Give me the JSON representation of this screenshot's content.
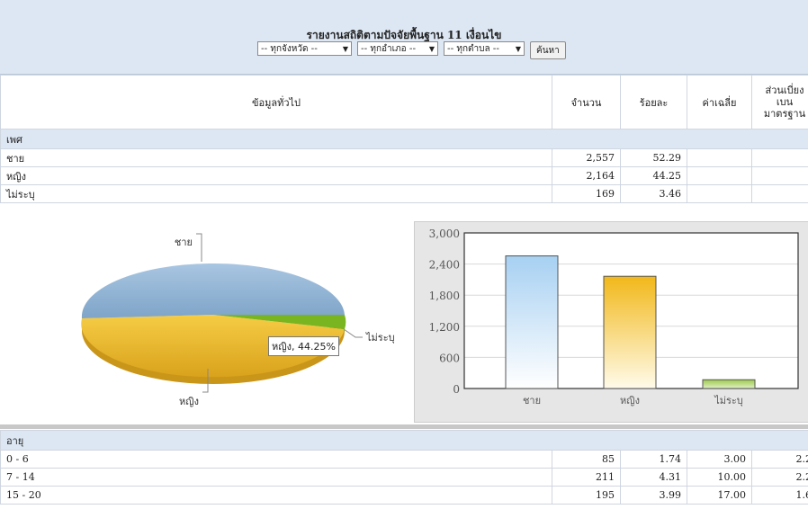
{
  "report": {
    "title": "รายงานสถิติตามปัจจัยพื้นฐาน 11 เงื่อนไข",
    "filters": {
      "province": "-- ทุกจังหวัด --",
      "district": "-- ทุกอำเภอ --",
      "subdistrict": "-- ทุกตำบล --",
      "search_label": "ค้นหา"
    }
  },
  "columns": {
    "general": "ข้อมูลทั่วไป",
    "count": "จำนวน",
    "percent": "ร้อยละ",
    "mean": "ค่าเฉลี่ย",
    "sd_line1": "ส่วนเบี่ยง",
    "sd_line2": "เบน",
    "sd_line3": "มาตรฐาน"
  },
  "sections": {
    "gender": {
      "label": "เพศ",
      "rows": [
        {
          "name": "ชาย",
          "count": "2,557",
          "percent": "52.29",
          "mean": "",
          "sd": ""
        },
        {
          "name": "หญิง",
          "count": "2,164",
          "percent": "44.25",
          "mean": "",
          "sd": ""
        },
        {
          "name": "ไม่ระบุ",
          "count": "169",
          "percent": "3.46",
          "mean": "",
          "sd": ""
        }
      ]
    },
    "age": {
      "label": "อายุ",
      "rows": [
        {
          "name": "0 - 6",
          "count": "85",
          "percent": "1.74",
          "mean": "3.00",
          "sd": "2.2"
        },
        {
          "name": "7 - 14",
          "count": "211",
          "percent": "4.31",
          "mean": "10.00",
          "sd": "2.2"
        },
        {
          "name": "15 - 20",
          "count": "195",
          "percent": "3.99",
          "mean": "17.00",
          "sd": "1.6"
        }
      ]
    }
  },
  "pie": {
    "labels": [
      "ชาย",
      "หญิง",
      "ไม่ระบุ"
    ],
    "tooltip": "หญิง, 44.25%"
  },
  "colors": {
    "header_bg": "#dde7f3",
    "male": "#92b5d6",
    "female": "#f2bc22",
    "unspecified": "#6aa112"
  },
  "chart_data": {
    "type": "bar",
    "categories": [
      "ชาย",
      "หญิง",
      "ไม่ระบุ"
    ],
    "values": [
      2557,
      2164,
      169
    ],
    "ylim": [
      0,
      3000
    ],
    "yticks": [
      "0",
      "600",
      "1,200",
      "1,800",
      "2,400",
      "3,000"
    ],
    "grid": true
  }
}
